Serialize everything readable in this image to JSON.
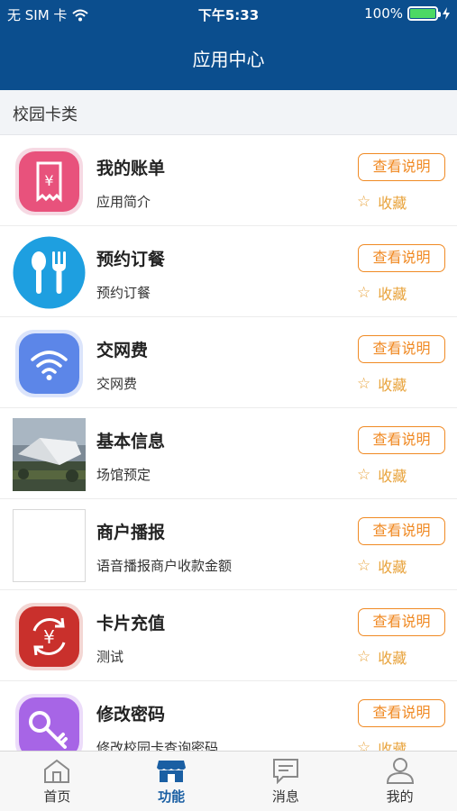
{
  "status_bar": {
    "carrier": "无 SIM 卡",
    "time": "下午5:33",
    "battery": "100%"
  },
  "nav": {
    "title": "应用中心"
  },
  "section": {
    "title": "校园卡类"
  },
  "apps": [
    {
      "name": "我的账单",
      "desc": "应用简介",
      "button": "查看说明",
      "favorite": "收藏",
      "icon": "bill-icon"
    },
    {
      "name": "预约订餐",
      "desc": "预约订餐",
      "button": "查看说明",
      "favorite": "收藏",
      "icon": "fork-spoon-icon"
    },
    {
      "name": "交网费",
      "desc": "交网费",
      "button": "查看说明",
      "favorite": "收藏",
      "icon": "wifi-icon"
    },
    {
      "name": "基本信息",
      "desc": "场馆预定",
      "button": "查看说明",
      "favorite": "收藏",
      "icon": "building-photo"
    },
    {
      "name": "商户播报",
      "desc": "语音播报商户收款金额",
      "button": "查看说明",
      "favorite": "收藏",
      "icon": "blank-icon"
    },
    {
      "name": "卡片充值",
      "desc": "测试",
      "button": "查看说明",
      "favorite": "收藏",
      "icon": "yen-recharge-icon"
    },
    {
      "name": "修改密码",
      "desc": "修改校园卡查询密码",
      "button": "查看说明",
      "favorite": "收藏",
      "icon": "key-icon"
    }
  ],
  "tabs": [
    {
      "label": "首页",
      "icon": "home-icon",
      "active": false
    },
    {
      "label": "功能",
      "icon": "store-icon",
      "active": true
    },
    {
      "label": "消息",
      "icon": "message-icon",
      "active": false
    },
    {
      "label": "我的",
      "icon": "person-icon",
      "active": false
    }
  ],
  "colors": {
    "nav_bg": "#0b4e8e",
    "accent": "#f08a24",
    "tab_active": "#1a5fa3"
  }
}
